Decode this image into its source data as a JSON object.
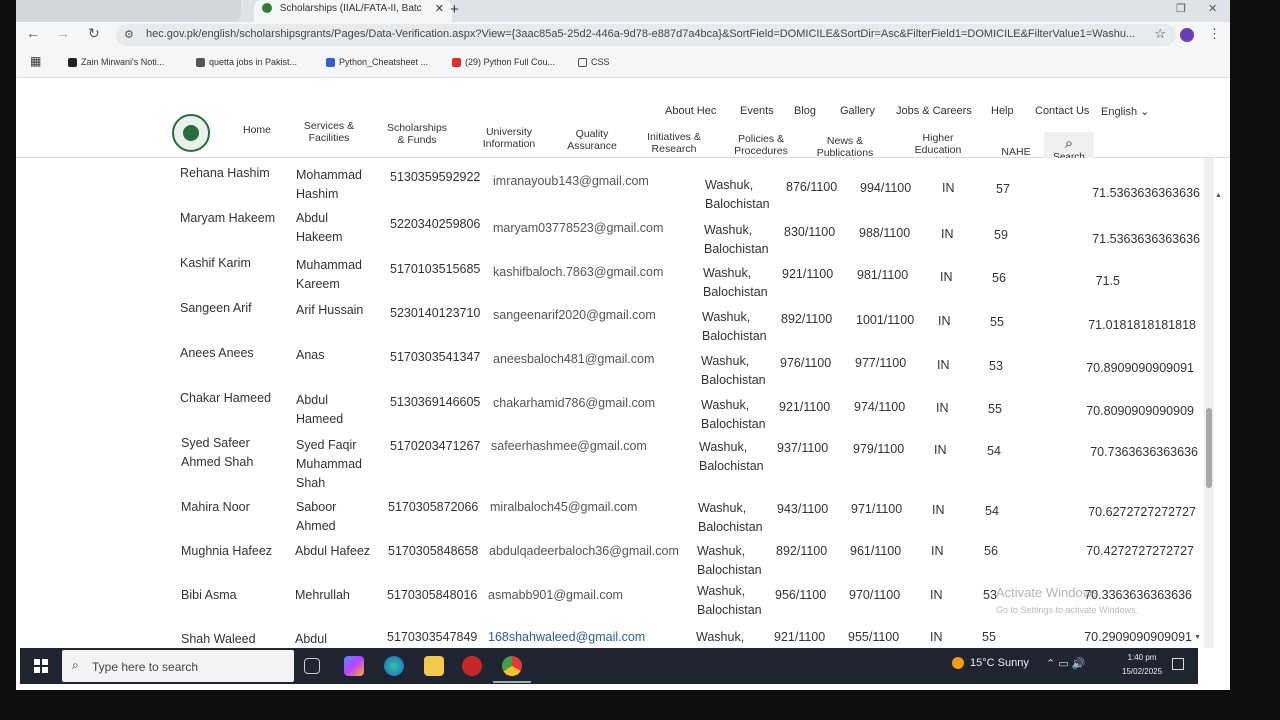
{
  "browser": {
    "tabs": [
      {
        "title": "",
        "active": false
      },
      {
        "title": "Scholarships (IIAL/FATA-II, Batc",
        "active": true
      }
    ],
    "url": "hec.gov.pk/english/scholarshipsgrants/Pages/Data-Verification.aspx?View={3aac85a5-25d2-446a-9d78-e887d7a4bca}&SortField=DOMICILE&SortDir=Asc&FilterField1=DOMICILE&FilterValue1=Washu...",
    "bookmarks": [
      "Zain Mirwani's Noti...",
      "quetta jobs in Pakist...",
      "Python_Cheatsheet ...",
      "(29) Python Full Cou...",
      "CSS"
    ]
  },
  "site": {
    "top_links": [
      "About Hec",
      "Events",
      "Blog",
      "Gallery",
      "Jobs & Careers",
      "Help",
      "Contact Us",
      "English"
    ],
    "nav": [
      "Home",
      "Services &\nFacilities",
      "Scholarships\n& Funds",
      "University\nInformation",
      "Quality\nAssurance",
      "Initiatives &\nResearch",
      "Policies &\nProcedures",
      "News &\nPublications",
      "Higher\nEducation\nStatistics",
      "NAHE"
    ],
    "search_label": "Search"
  },
  "rows": [
    {
      "name": "Rehana Hashim",
      "father": "Mohammad\nHashim",
      "cnic": "5130359592922",
      "email": "imranayoub143@gmail.com",
      "domicile": "Washuk,\nBalochistan",
      "marks1": "876/1100",
      "marks2": "994/1100",
      "in": "IN",
      "age": "57",
      "score": "71.5363636363636"
    },
    {
      "name": "Maryam Hakeem",
      "father": "Abdul\nHakeem",
      "cnic": "5220340259806",
      "email": "maryam03778523@gmail.com",
      "domicile": "Washuk,\nBalochistan",
      "marks1": "830/1100",
      "marks2": "988/1100",
      "in": "IN",
      "age": "59",
      "score": "71.5363636363636"
    },
    {
      "name": "Kashif Karim",
      "father": "Muhammad\nKareem",
      "cnic": "5170103515685",
      "email": "kashifbaloch.7863@gmail.com",
      "domicile": "Washuk,\nBalochistan",
      "marks1": "921/1100",
      "marks2": "981/1100",
      "in": "IN",
      "age": "56",
      "score": "71.5"
    },
    {
      "name": "Sangeen Arif",
      "father": "Arif Hussain",
      "cnic": "5230140123710",
      "email": "sangeenarif2020@gmail.com",
      "domicile": "Washuk,\nBalochistan",
      "marks1": "892/1100",
      "marks2": "1001/1100",
      "in": "IN",
      "age": "55",
      "score": "71.0181818181818"
    },
    {
      "name": "Anees Anees",
      "father": "Anas",
      "cnic": "5170303541347",
      "email": "aneesbaloch481@gmail.com",
      "domicile": "Washuk,\nBalochistan",
      "marks1": "976/1100",
      "marks2": "977/1100",
      "in": "IN",
      "age": "53",
      "score": "70.8909090909091"
    },
    {
      "name": "Chakar Hameed",
      "father": "Abdul\nHameed",
      "cnic": "5130369146605",
      "email": "chakarhamid786@gmail.com",
      "domicile": "Washuk,\nBalochistan",
      "marks1": "921/1100",
      "marks2": "974/1100",
      "in": "IN",
      "age": "55",
      "score": "70.8090909090909"
    },
    {
      "name": "Syed Safeer\nAhmed Shah",
      "father": "Syed Faqir\nMuhammad\nShah",
      "cnic": "5170203471267",
      "email": "safeerhashmee@gmail.com",
      "domicile": "Washuk,\nBalochistan",
      "marks1": "937/1100",
      "marks2": "979/1100",
      "in": "IN",
      "age": "54",
      "score": "70.7363636363636"
    },
    {
      "name": "Mahira Noor",
      "father": "Saboor\nAhmed",
      "cnic": "5170305872066",
      "email": "miralbaloch45@gmail.com",
      "domicile": "Washuk,\nBalochistan",
      "marks1": "943/1100",
      "marks2": "971/1100",
      "in": "IN",
      "age": "54",
      "score": "70.6272727272727"
    },
    {
      "name": "Mughnia  Hafeez",
      "father": "Abdul Hafeez",
      "cnic": "5170305848658",
      "email": "abdulqadeerbaloch36@gmail.com",
      "domicile": "Washuk,\nBalochistan",
      "marks1": "892/1100",
      "marks2": "961/1100",
      "in": "IN",
      "age": "56",
      "score": "70.4272727272727"
    },
    {
      "name": "Bibi Asma",
      "father": "Mehrullah",
      "cnic": "5170305848016",
      "email": "asmabb901@gmail.com",
      "domicile": "Washuk,\nBalochistan",
      "marks1": "956/1100",
      "marks2": "970/1100",
      "in": "IN",
      "age": "53",
      "score": "70.3363636363636"
    },
    {
      "name": "Shah Waleed",
      "father": "Abdul",
      "cnic": "5170303547849",
      "email": "168shahwaleed@gmail.com",
      "domicile": "Washuk,",
      "marks1": "921/1100",
      "marks2": "955/1100",
      "in": "IN",
      "age": "55",
      "score": "70.2909090909091"
    }
  ],
  "watermark": {
    "title": "Activate Windows",
    "subtitle": "Go to Settings to activate Windows."
  },
  "taskbar": {
    "search_placeholder": "Type here to search",
    "weather": "15°C  Sunny",
    "time": "1:40 pm",
    "date": "15/02/2025"
  }
}
